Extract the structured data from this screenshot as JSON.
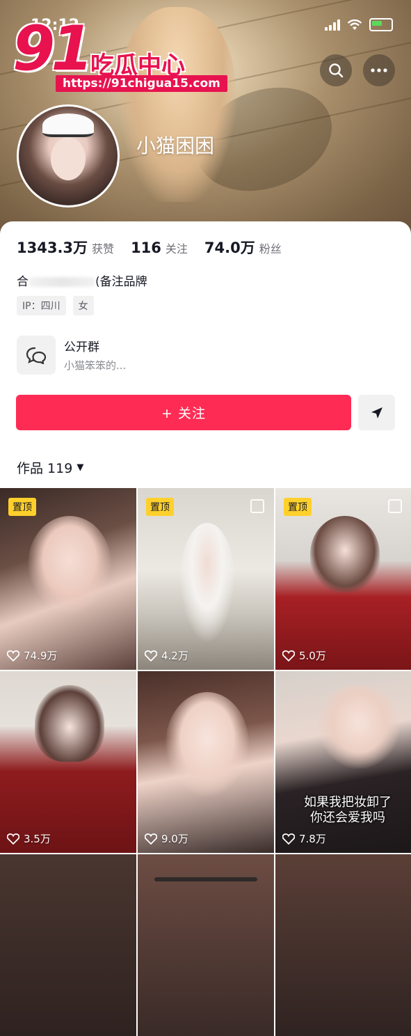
{
  "status_bar": {
    "time": "12:12"
  },
  "watermark": {
    "number": "91",
    "name": "吃瓜中心",
    "url": "https://91chigua15.com"
  },
  "profile": {
    "username": "小猫困困",
    "stats": [
      {
        "value": "1343.3万",
        "label": "获赞"
      },
      {
        "value": "116",
        "label": "关注"
      },
      {
        "value": "74.0万",
        "label": "粉丝"
      }
    ],
    "bio_start": "合",
    "bio_end": "(备注品牌",
    "tags": [
      "IP：四川",
      "女"
    ],
    "group": {
      "title": "公开群",
      "subtitle": "小猫笨笨的..."
    },
    "follow_label": "+ 关注",
    "works_label": "作品 119"
  },
  "videos": [
    {
      "likes": "74.9万",
      "pinned": true,
      "pin_label": "置顶",
      "multi": false,
      "caption": ""
    },
    {
      "likes": "4.2万",
      "pinned": true,
      "pin_label": "置顶",
      "multi": true,
      "caption": ""
    },
    {
      "likes": "5.0万",
      "pinned": true,
      "pin_label": "置顶",
      "multi": true,
      "caption": ""
    },
    {
      "likes": "3.5万",
      "pinned": false,
      "pin_label": "",
      "multi": false,
      "caption": ""
    },
    {
      "likes": "9.0万",
      "pinned": false,
      "pin_label": "",
      "multi": false,
      "caption": ""
    },
    {
      "likes": "7.8万",
      "pinned": false,
      "pin_label": "",
      "multi": false,
      "caption": "如果我把妆卸了\n你还会爱我吗"
    }
  ],
  "colors": {
    "accent": "#fe2c55",
    "pin": "#ffd02b",
    "watermark": "#e8124f"
  }
}
